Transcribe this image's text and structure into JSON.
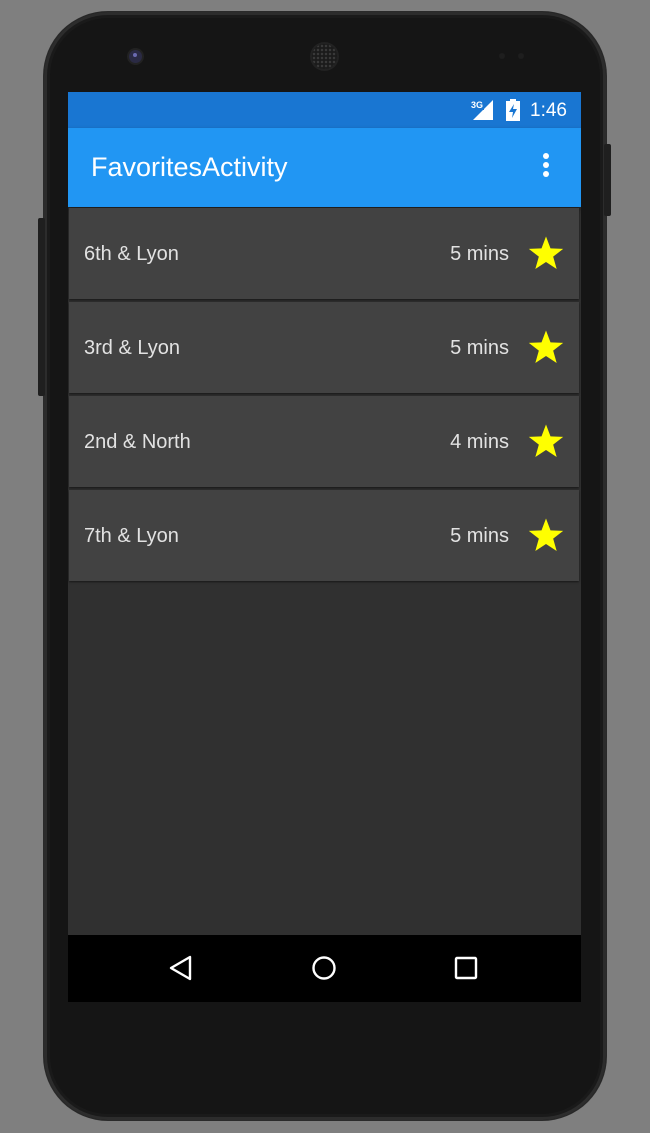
{
  "status_bar": {
    "network": "3G",
    "time": "1:46"
  },
  "app_bar": {
    "title": "FavoritesActivity",
    "overflow_icon": "more-vert-icon"
  },
  "favorites": [
    {
      "name": "6th & Lyon",
      "eta": "5 mins",
      "favorited": true
    },
    {
      "name": "3rd & Lyon",
      "eta": "5 mins",
      "favorited": true
    },
    {
      "name": "2nd & North",
      "eta": "4 mins",
      "favorited": true
    },
    {
      "name": "7th & Lyon",
      "eta": "5 mins",
      "favorited": true
    }
  ],
  "nav_bar": {
    "back_icon": "back-triangle-icon",
    "home_icon": "home-circle-icon",
    "recents_icon": "recents-square-icon"
  },
  "colors": {
    "status_bar": "#1976d2",
    "app_bar": "#2196f3",
    "background": "#303030",
    "row": "#424242",
    "star": "#ffff00",
    "text": "#e2e2e2"
  }
}
